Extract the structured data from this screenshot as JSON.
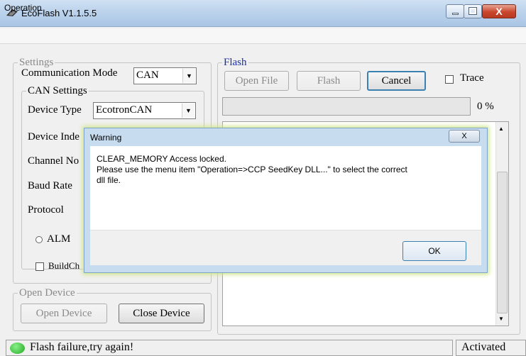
{
  "window": {
    "title": "EcoFlash V1.1.5.5",
    "close_glyph": "X"
  },
  "menu": {
    "items": [
      "Operation"
    ]
  },
  "settings": {
    "legend": "Settings",
    "comm_mode_label": "Communication Mode",
    "comm_mode_value": "CAN",
    "can_settings": {
      "legend": "CAN Settings",
      "device_type_label": "Device Type",
      "device_type_value": "EcotronCAN",
      "device_index_label": "Device Inde",
      "channel_label": "Channel No",
      "baud_label": "Baud Rate",
      "protocol_label": "Protocol"
    },
    "alm_label": "ALM",
    "buildcheck_label": "BuildCh"
  },
  "open_device": {
    "legend": "Open Device",
    "open_button": "Open Device",
    "close_button": "Close Device"
  },
  "flash": {
    "legend": "Flash",
    "open_file_button": "Open File",
    "flash_button": "Flash",
    "cancel_button": "Cancel",
    "trace_label": "Trace",
    "progress_percent": 0,
    "progress_text": "0 %"
  },
  "dialog": {
    "title": "Warning",
    "message": "CLEAR_MEMORY Access locked.\nPlease use the menu item \"Operation=>CCP SeedKey DLL...\" to select the correct\ndll file.",
    "ok_button": "OK",
    "close_glyph": "X"
  },
  "status": {
    "message": "Flash failure,try again!",
    "state": "Activated",
    "led_color": "#22aa22"
  }
}
